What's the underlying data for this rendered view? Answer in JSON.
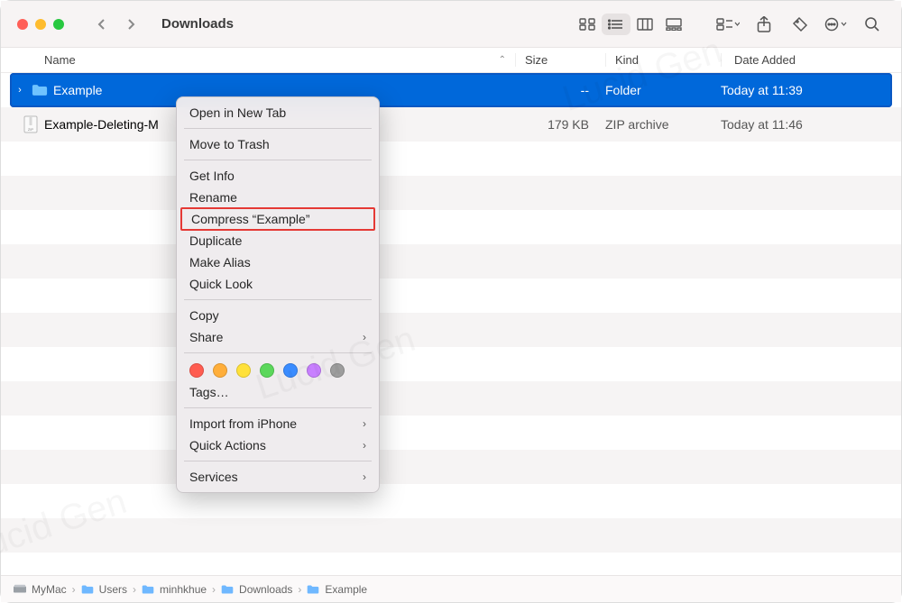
{
  "window": {
    "title": "Downloads"
  },
  "columns": {
    "name": "Name",
    "size": "Size",
    "kind": "Kind",
    "date": "Date Added"
  },
  "rows": [
    {
      "name": "Example",
      "size": "--",
      "kind": "Folder",
      "date": "Today at 11:39"
    },
    {
      "name": "Example-Deleting-M",
      "size": "179 KB",
      "kind": "ZIP archive",
      "date": "Today at 11:46"
    }
  ],
  "context_menu": {
    "open_new_tab": "Open in New Tab",
    "move_to_trash": "Move to Trash",
    "get_info": "Get Info",
    "rename": "Rename",
    "compress": "Compress “Example”",
    "duplicate": "Duplicate",
    "make_alias": "Make Alias",
    "quick_look": "Quick Look",
    "copy": "Copy",
    "share": "Share",
    "tags": "Tags…",
    "import_iphone": "Import from iPhone",
    "quick_actions": "Quick Actions",
    "services": "Services"
  },
  "tag_colors": [
    "#ff5c50",
    "#ffae3a",
    "#ffe13a",
    "#5bd75b",
    "#3a8cff",
    "#c880ff",
    "#9d9d9d"
  ],
  "path": [
    "MyMac",
    "Users",
    "minhkhue",
    "Downloads",
    "Example"
  ]
}
